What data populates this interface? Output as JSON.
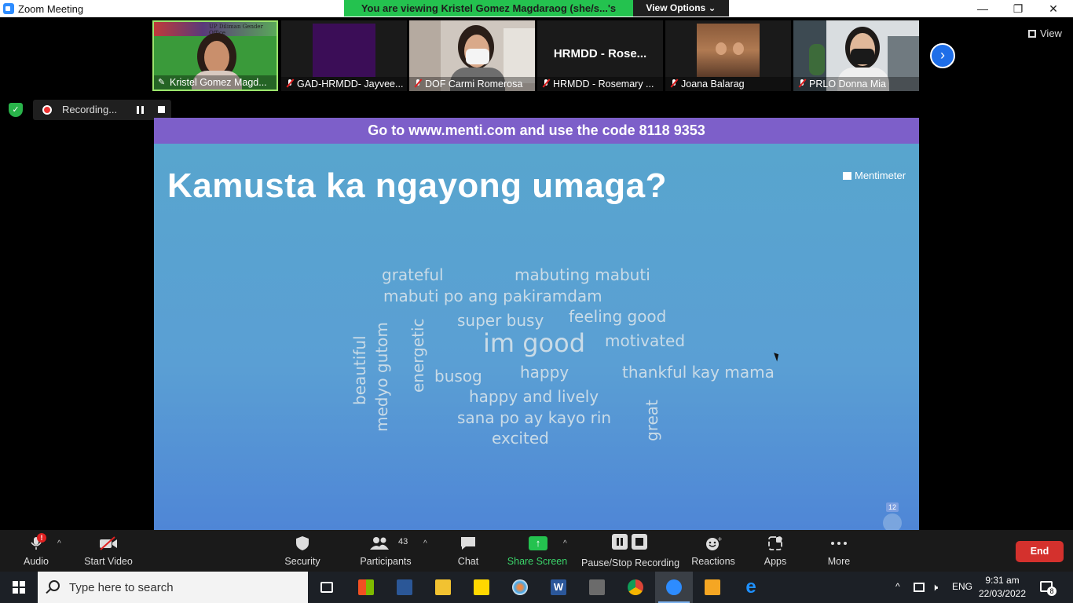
{
  "window": {
    "title": "Zoom Meeting",
    "controls": [
      "—",
      "❐",
      "✕"
    ]
  },
  "banner": {
    "viewing_text": "You are viewing Kristel Gomez Magdaraog (she/s...'s screen",
    "view_options": "View Options ⌄"
  },
  "participants_strip": [
    {
      "name": "Kristel Gomez Magd...",
      "overlay": "UP Diliman Gender Office"
    },
    {
      "name": "GAD-HRMDD- Jayvee..."
    },
    {
      "name": "DOF Carmi Romerosa"
    },
    {
      "name": "HRMDD - Rosemary ...",
      "overlay": "HRMDD - Rose..."
    },
    {
      "name": "Joana Balarag"
    },
    {
      "name": "PRLO Donna Mia"
    }
  ],
  "view_button": "View",
  "recording": {
    "status": "Recording..."
  },
  "slide": {
    "banner": "Go to www.menti.com and use the code 8118 9353",
    "question": "Kamusta ka ngayong umaga?",
    "logo": "Mentimeter",
    "voter_count": "12",
    "words": [
      {
        "text": "grateful",
        "size": 20
      },
      {
        "text": "mabuting mabuti",
        "size": 20
      },
      {
        "text": "mabuti po ang pakiramdam",
        "size": 20
      },
      {
        "text": "super busy",
        "size": 20
      },
      {
        "text": "feeling good",
        "size": 20
      },
      {
        "text": "im good",
        "size": 32
      },
      {
        "text": "motivated",
        "size": 20
      },
      {
        "text": "busog",
        "size": 20
      },
      {
        "text": "happy",
        "size": 20
      },
      {
        "text": "thankful kay mama",
        "size": 20
      },
      {
        "text": "happy and lively",
        "size": 20
      },
      {
        "text": "sana po ay kayo rin",
        "size": 20
      },
      {
        "text": "excited",
        "size": 20
      },
      {
        "text": "beautiful",
        "size": 20
      },
      {
        "text": "medyo gutom",
        "size": 20
      },
      {
        "text": "energetic",
        "size": 20
      },
      {
        "text": "great",
        "size": 20
      }
    ]
  },
  "toolbar": {
    "audio": "Audio",
    "audio_alert": "!",
    "start_video": "Start Video",
    "security": "Security",
    "participants": "Participants",
    "participants_count": "43",
    "chat": "Chat",
    "share_screen": "Share Screen",
    "pause_stop_recording": "Pause/Stop Recording",
    "reactions": "Reactions",
    "apps": "Apps",
    "more": "More",
    "end": "End"
  },
  "taskbar": {
    "search_placeholder": "Type here to search",
    "language": "ENG",
    "time": "9:31 am",
    "date": "22/03/2022",
    "notification_count": "8"
  },
  "colors": {
    "banner_green": "#24c24f",
    "menti_purple": "#7d5fc9",
    "end_red": "#d4312d",
    "share_green": "#24c24f"
  }
}
